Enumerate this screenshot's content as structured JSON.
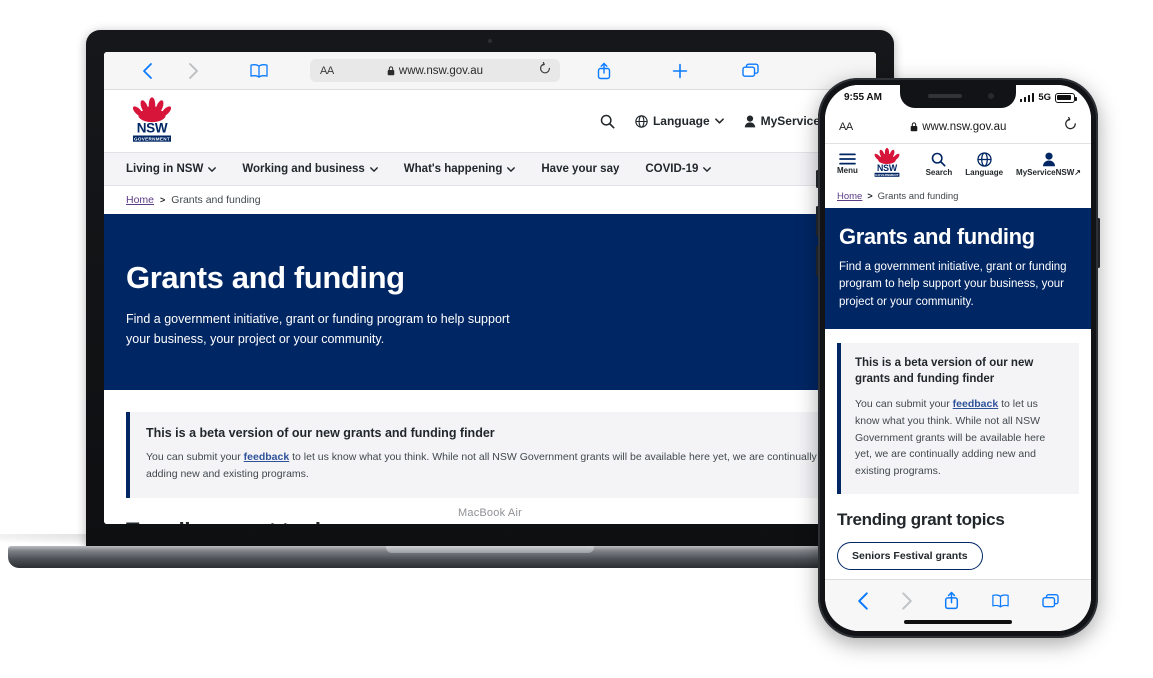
{
  "device_labels": {
    "macbook": "MacBook Air"
  },
  "laptop": {
    "browser": {
      "back_icon": "chevron-left",
      "forward_icon": "chevron-right",
      "bookmarks_icon": "book",
      "text_size_label": "AA",
      "lock_icon": "lock",
      "url": "www.nsw.gov.au",
      "reload_icon": "reload",
      "share_icon": "share",
      "new_tab_icon": "plus",
      "tabs_icon": "tabs"
    },
    "site": {
      "logo": {
        "name": "NSW",
        "sub": "GOVERNMENT"
      },
      "header_actions": [
        {
          "icon": "search-icon",
          "label": ""
        },
        {
          "icon": "globe-icon",
          "label": "Language",
          "caret": true
        },
        {
          "icon": "person-icon",
          "label": "MyServiceNSW"
        }
      ],
      "nav": [
        {
          "label": "Living in NSW",
          "caret": true
        },
        {
          "label": "Working and business",
          "caret": true
        },
        {
          "label": "What's happening",
          "caret": true
        },
        {
          "label": "Have your say",
          "caret": false
        },
        {
          "label": "COVID-19",
          "caret": true
        }
      ],
      "breadcrumb": {
        "home": "Home",
        "separator": ">",
        "current": "Grants and funding"
      },
      "hero": {
        "title": "Grants and funding",
        "subtitle": "Find a government initiative, grant or funding program to help support your business, your project or your community."
      },
      "beta": {
        "heading": "This is a beta version of our new grants and funding finder",
        "body_before": "You can submit your ",
        "link": "feedback",
        "body_after": " to let us know what you think. While not all NSW Government grants will be available here yet, we are continually adding new and existing programs."
      },
      "trending_heading": "Trending grant topics"
    }
  },
  "phone": {
    "status": {
      "time": "9:55 AM",
      "network": "5G",
      "signal_icon": "signal-bars",
      "battery_icon": "battery"
    },
    "browser": {
      "text_size_label": "AA",
      "lock_icon": "lock",
      "url": "www.nsw.gov.au",
      "reload_icon": "reload",
      "back_icon": "chevron-left",
      "forward_icon": "chevron-right",
      "share_icon": "share",
      "bookmarks_icon": "book",
      "tabs_icon": "tabs"
    },
    "site": {
      "nav": [
        {
          "icon": "hamburger-icon",
          "label": "Menu"
        },
        {
          "icon": "nsw-logo",
          "label": ""
        },
        {
          "icon": "search-icon",
          "label": "Search"
        },
        {
          "icon": "globe-icon",
          "label": "Language"
        },
        {
          "icon": "person-icon",
          "label": "MyServiceNSW",
          "external": "↗"
        }
      ],
      "breadcrumb": {
        "home": "Home",
        "separator": ">",
        "current": "Grants and funding"
      },
      "hero": {
        "title": "Grants and funding",
        "subtitle": "Find a government initiative, grant or funding program to help support your business, your project or your community."
      },
      "beta": {
        "heading": "This is a beta version of our new grants and funding finder",
        "body_before": "You can submit your ",
        "link": "feedback",
        "body_after": " to let us know what you think. While not all NSW Government grants will be available here yet, we are continually adding new and existing programs."
      },
      "trending_heading": "Trending grant topics",
      "chips": [
        "Seniors Festival grants"
      ]
    }
  },
  "colors": {
    "nsw_navy": "#002664",
    "nsw_red": "#d7153a",
    "safari_blue": "#0b7bff",
    "link_blue": "#2e5299",
    "grey_panel": "#f4f4f7"
  }
}
